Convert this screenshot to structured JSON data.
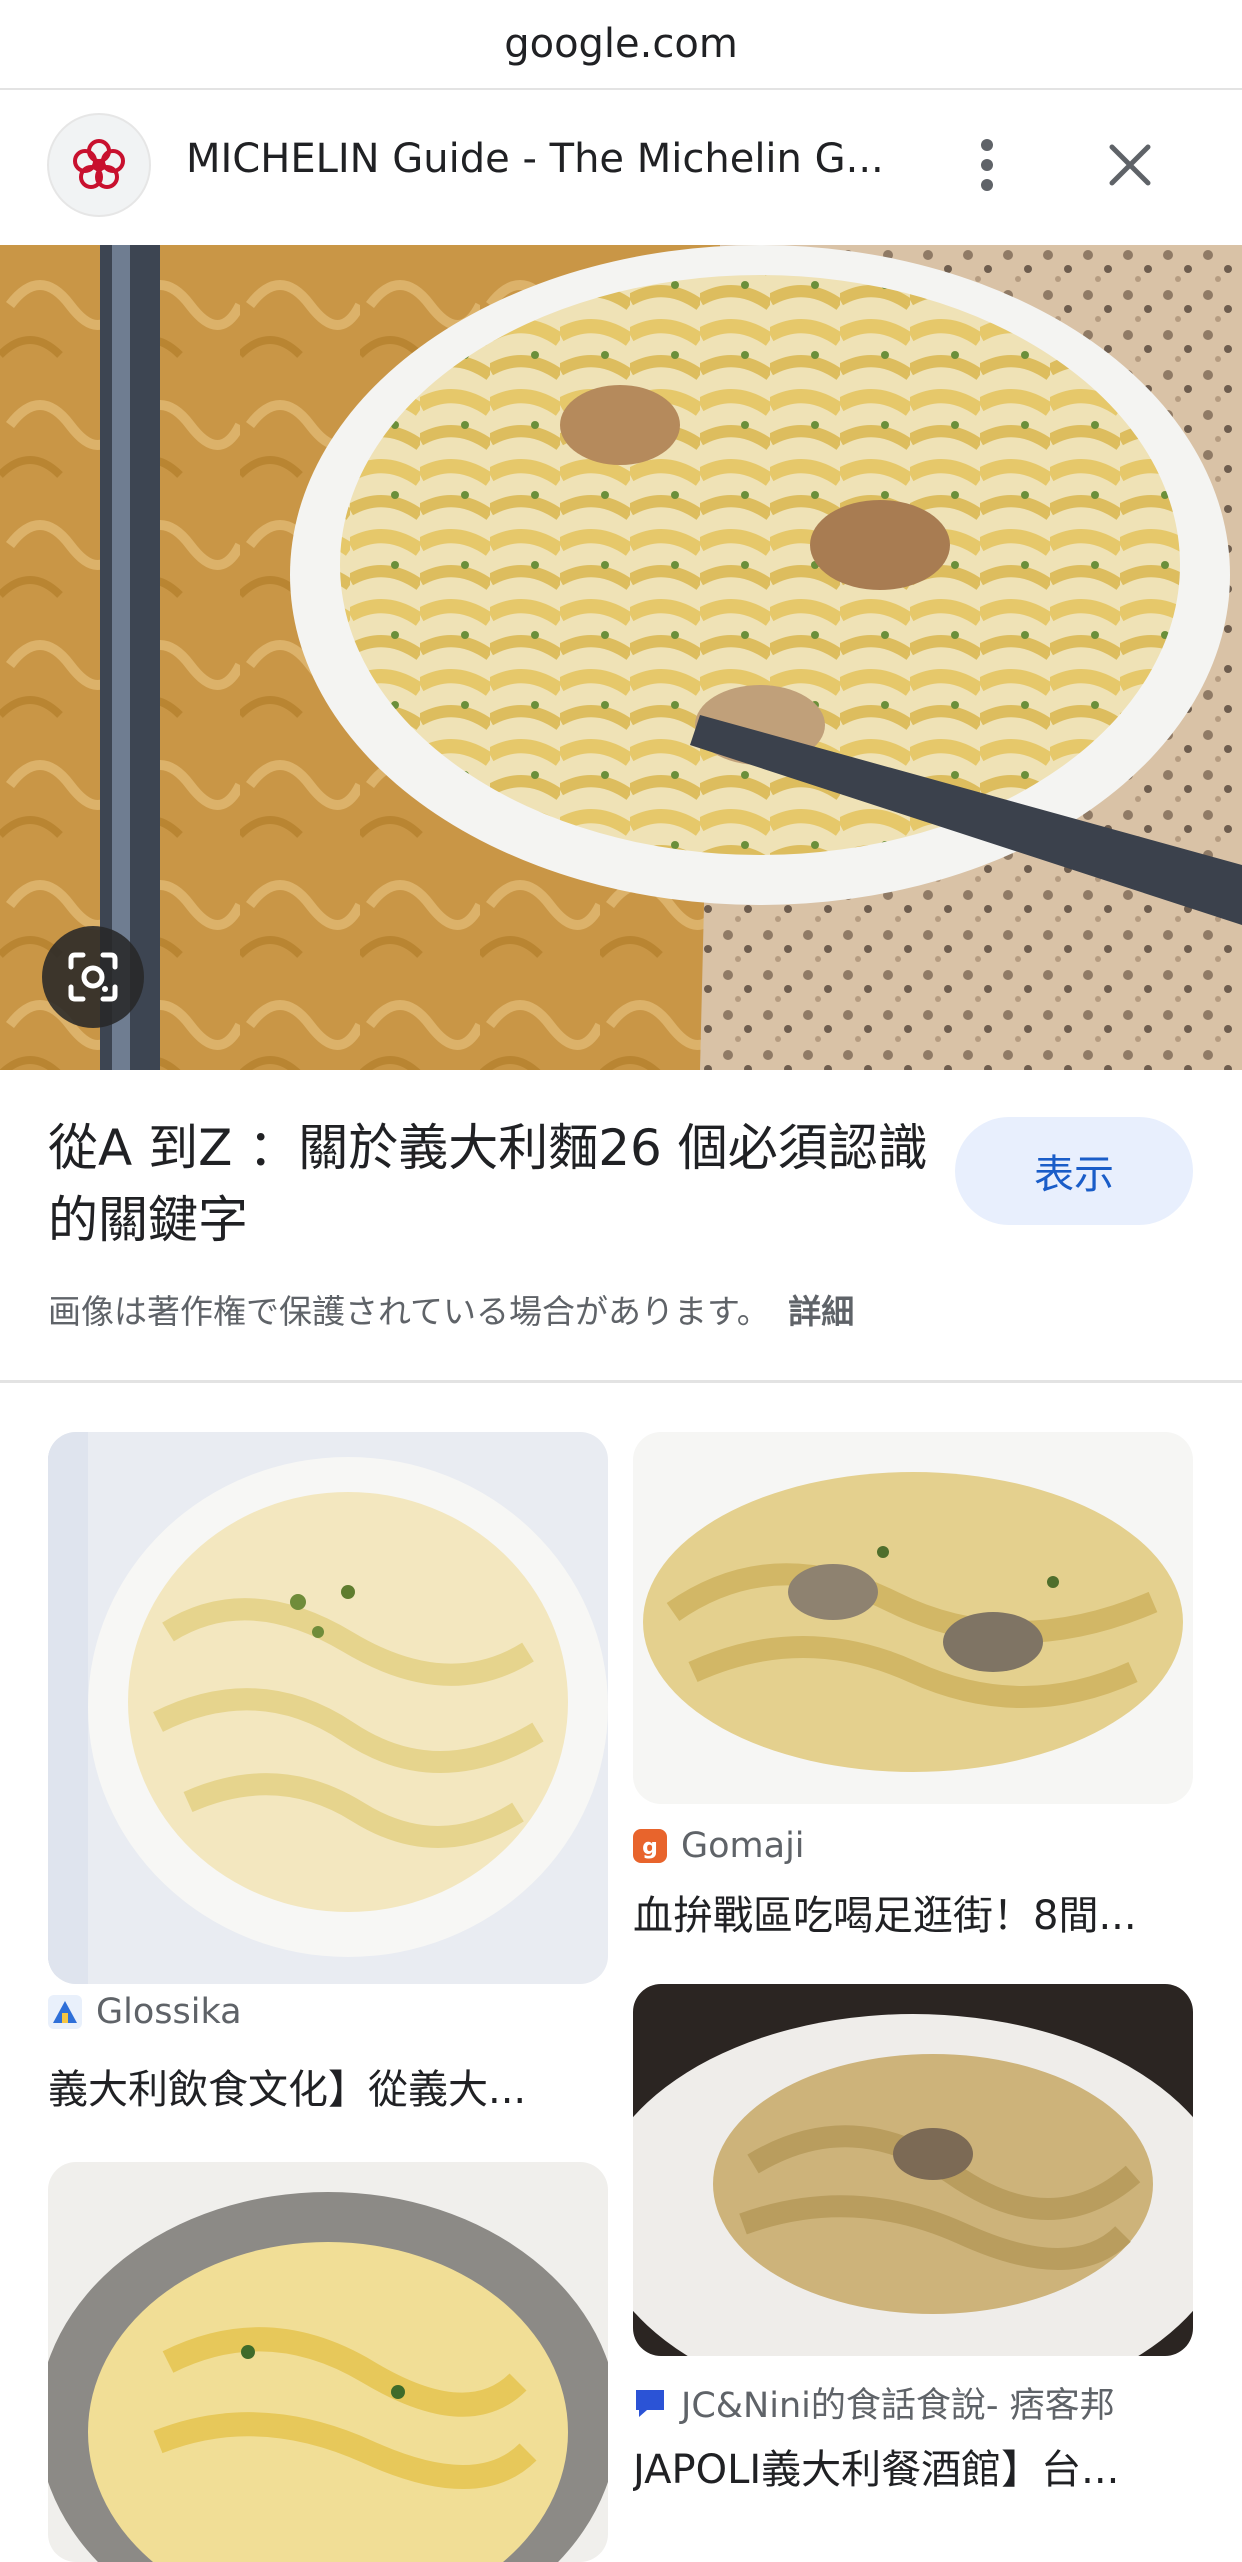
{
  "urlbar": {
    "domain": "google.com"
  },
  "header": {
    "title": "MICHELIN Guide - The Michelin G..."
  },
  "result": {
    "title": "從A 到Z ：關於義大利麵26 個必須認識的關鍵字",
    "show_label": "表示",
    "copyright_notice": "画像は著作権で保護されている場合があります。",
    "details_label": "詳細"
  },
  "related": [
    {
      "source": "Glossika",
      "caption": "義大利飲食文化】從義大...",
      "source_color": "#2e6fd8"
    },
    {
      "source": "Gomaji",
      "caption": "血拚戰區吃喝足逛街！8間...",
      "source_color": "#e8642c"
    },
    {
      "source": "JC&Nini的食話食說- 痞客邦",
      "caption": "JAPOLI義大利餐酒館】台...",
      "source_color": "#2b53d6"
    }
  ],
  "colors": {
    "accent": "#1a5dc8",
    "show_bg": "#e8effd",
    "michelin_red": "#c8102e"
  }
}
